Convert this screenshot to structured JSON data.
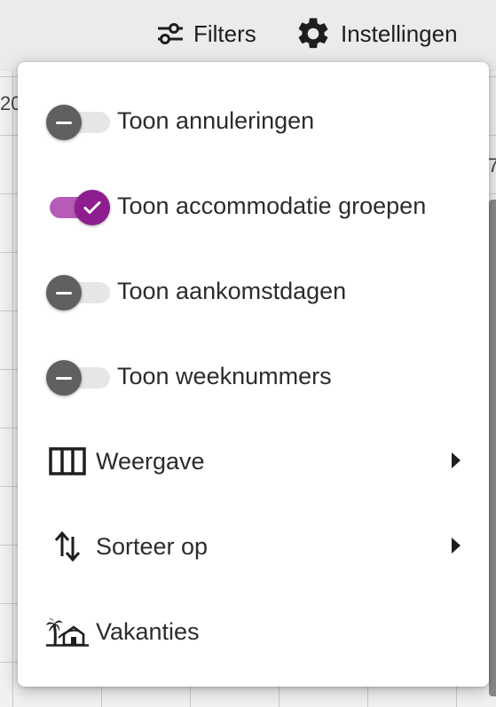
{
  "toolbar": {
    "filters_label": "Filters",
    "settings_label": "Instellingen"
  },
  "background": {
    "fragment_left": "20",
    "fragment_right": "7"
  },
  "menu": {
    "toggles": [
      {
        "label": "Toon annuleringen",
        "checked": false
      },
      {
        "label": "Toon accommodatie groepen",
        "checked": true
      },
      {
        "label": "Toon aankomstdagen",
        "checked": false
      },
      {
        "label": "Toon weeknummers",
        "checked": false
      }
    ],
    "items": [
      {
        "label": "Weergave",
        "icon": "columns-icon",
        "submenu": true
      },
      {
        "label": "Sorteer op",
        "icon": "sort-icon",
        "submenu": true
      },
      {
        "label": "Vakanties",
        "icon": "holiday-icon",
        "submenu": false
      }
    ]
  },
  "colors": {
    "toggle_on_knob": "#8e1d8f",
    "toggle_on_track": "#b65cb8",
    "toggle_off_knob": "#606060",
    "toggle_off_track": "#e6e6e6"
  }
}
